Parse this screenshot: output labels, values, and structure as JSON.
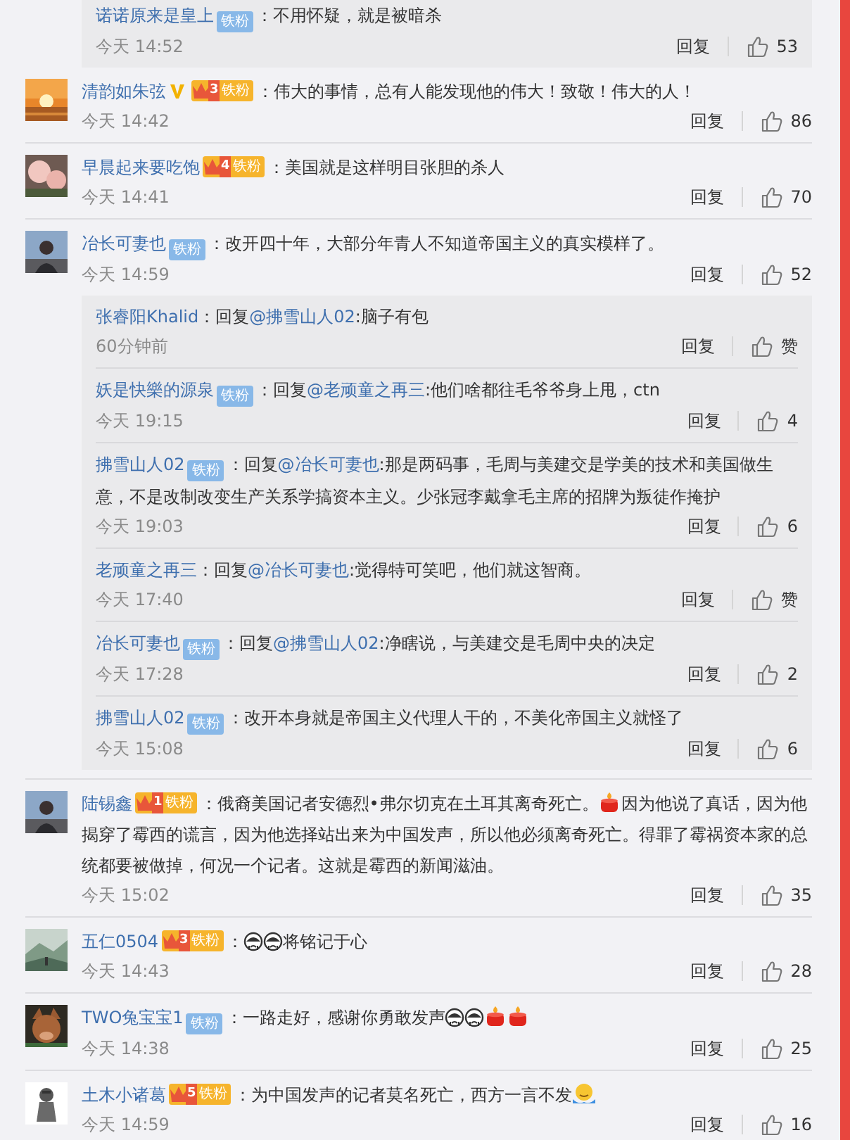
{
  "top_reply_box": {
    "replies": [
      {
        "user": "诺诺原来是皇上",
        "badge": {
          "label": "铁粉"
        },
        "text": [
          {
            "text": "：不用怀疑，就是被暗杀"
          }
        ],
        "time": "今天 14:52",
        "reply_label": "回复",
        "likes": "53"
      }
    ]
  },
  "comments": [
    {
      "user": "清韵如朱弦",
      "verified": true,
      "badge": {
        "crown": "3",
        "label": "铁粉"
      },
      "text": [
        {
          "text": "：伟大的事情，总有人能发现他的伟大！致敬！伟大的人！"
        }
      ],
      "time": "今天 14:42",
      "reply_label": "回复",
      "likes": "86"
    },
    {
      "user": "早晨起来要吃饱",
      "verified": false,
      "badge": {
        "crown": "4",
        "label": "铁粉"
      },
      "text": [
        {
          "text": "：美国就是这样明目张胆的杀人"
        }
      ],
      "time": "今天 14:41",
      "reply_label": "回复",
      "likes": "70"
    },
    {
      "user": "冶长可妻也",
      "verified": false,
      "badge": {
        "label": "铁粉"
      },
      "text": [
        {
          "text": "：改开四十年，大部分年青人不知道帝国主义的真实模样了。"
        }
      ],
      "time": "今天 14:59",
      "reply_label": "回复",
      "likes": "52",
      "replies": [
        {
          "user": "张睿阳Khalid",
          "text": [
            {
              "text": "：回复"
            },
            {
              "mention": "@拂雪山人02"
            },
            {
              "text": ":脑子有包"
            }
          ],
          "time": "60分钟前",
          "reply_label": "回复",
          "likes": "赞"
        },
        {
          "user": "妖是快樂的源泉",
          "badge": {
            "label": "铁粉"
          },
          "text": [
            {
              "text": "：回复"
            },
            {
              "mention": "@老顽童之再三"
            },
            {
              "text": ":他们啥都往毛爷爷身上甩，ctn"
            }
          ],
          "time": "今天 19:15",
          "reply_label": "回复",
          "likes": "4"
        },
        {
          "user": "拂雪山人02",
          "badge": {
            "label": "铁粉"
          },
          "text": [
            {
              "text": "：回复"
            },
            {
              "mention": "@冶长可妻也"
            },
            {
              "text": ":那是两码事，毛周与美建交是学美的技术和美国做生意，不是改制改变生产关系学搞资本主义。少张冠李戴拿毛主席的招牌为叛徒作掩护"
            }
          ],
          "time": "今天 19:03",
          "reply_label": "回复",
          "likes": "6"
        },
        {
          "user": "老顽童之再三",
          "text": [
            {
              "text": "：回复"
            },
            {
              "mention": "@冶长可妻也"
            },
            {
              "text": ":觉得特可笑吧，他们就这智商。"
            }
          ],
          "time": "今天 17:40",
          "reply_label": "回复",
          "likes": "赞"
        },
        {
          "user": "冶长可妻也",
          "badge": {
            "label": "铁粉"
          },
          "text": [
            {
              "text": "：回复"
            },
            {
              "mention": "@拂雪山人02"
            },
            {
              "text": ":净瞎说，与美建交是毛周中央的决定"
            }
          ],
          "time": "今天 17:28",
          "reply_label": "回复",
          "likes": "2"
        },
        {
          "user": "拂雪山人02",
          "badge": {
            "label": "铁粉"
          },
          "text": [
            {
              "text": "：改开本身就是帝国主义代理人干的，不美化帝国主义就怪了"
            }
          ],
          "time": "今天 15:08",
          "reply_label": "回复",
          "likes": "6"
        }
      ]
    },
    {
      "user": "陆锡鑫",
      "verified": false,
      "badge": {
        "crown": "1",
        "label": "铁粉"
      },
      "text": [
        {
          "text": "：俄裔美国记者安德烈•弗尔切克在土耳其离奇死亡。"
        },
        {
          "kind": "candle"
        },
        {
          "text": "因为他说了真话，因为他揭穿了霉西的谎言，因为他选择站出来为中国发声，所以他必须离奇死亡。得罪了霉祸资本家的总统都要被做掉，何况一个记者。这就是霉西的新闻滋油。"
        }
      ],
      "time": "今天 15:02",
      "reply_label": "回复",
      "likes": "35"
    },
    {
      "user": "五仁0504",
      "verified": false,
      "badge": {
        "crown": "3",
        "label": "铁粉"
      },
      "text": [
        {
          "text": "："
        },
        {
          "kind": "crying"
        },
        {
          "kind": "crying"
        },
        {
          "text": "将铭记于心"
        }
      ],
      "time": "今天 14:43",
      "reply_label": "回复",
      "likes": "28"
    },
    {
      "user": "TWO兔宝宝1",
      "verified": false,
      "badge": {
        "label": "铁粉"
      },
      "text": [
        {
          "text": "：一路走好，感谢你勇敢发声"
        },
        {
          "kind": "crying"
        },
        {
          "kind": "crying"
        },
        {
          "kind": "candle"
        },
        {
          "kind": "candle"
        }
      ],
      "time": "今天 14:38",
      "reply_label": "回复",
      "likes": "25"
    },
    {
      "user": "土木小诸葛",
      "verified": false,
      "badge": {
        "crown": "5",
        "label": "铁粉"
      },
      "text": [
        {
          "text": "：为中国发声的记者莫名死亡，西方一言不发"
        },
        {
          "kind": "shrug"
        }
      ],
      "time": "今天 14:59",
      "reply_label": "回复",
      "likes": "16"
    }
  ]
}
